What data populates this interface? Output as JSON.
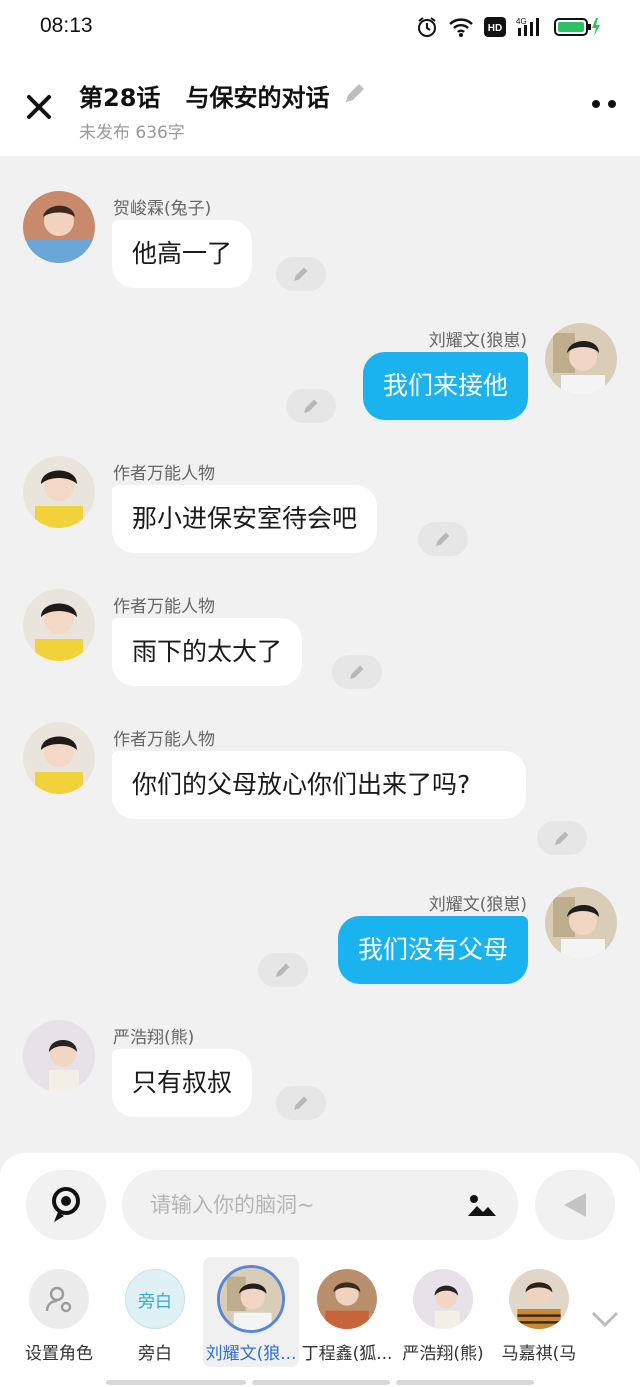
{
  "status": {
    "time": "08:13"
  },
  "header": {
    "title": "第28话   与保安的对话",
    "subtitle": "未发布 636字"
  },
  "messages": [
    {
      "side": "left",
      "name": "贺峻霖(兔子)",
      "text": "他高一了"
    },
    {
      "side": "right",
      "name": "刘耀文(狼崽)",
      "text": "我们来接他"
    },
    {
      "side": "left",
      "name": "作者万能人物",
      "text": "那小进保安室待会吧"
    },
    {
      "side": "left",
      "name": "作者万能人物",
      "text": "雨下的太大了"
    },
    {
      "side": "left",
      "name": "作者万能人物",
      "text": "你们的父母放心你们出来了吗?"
    },
    {
      "side": "right",
      "name": "刘耀文(狼崽)",
      "text": "我们没有父母"
    },
    {
      "side": "left",
      "name": "严浩翔(熊)",
      "text": "只有叔叔"
    }
  ],
  "composer": {
    "placeholder": "请输入你的脑洞~"
  },
  "roles": [
    {
      "label": "设置角色",
      "icon": "person-settings-icon"
    },
    {
      "label": "旁白",
      "badge": "旁白"
    },
    {
      "label": "刘耀文(狼...",
      "active": true
    },
    {
      "label": "丁程鑫(狐..."
    },
    {
      "label": "严浩翔(熊)"
    },
    {
      "label": "马嘉祺(马"
    }
  ]
}
